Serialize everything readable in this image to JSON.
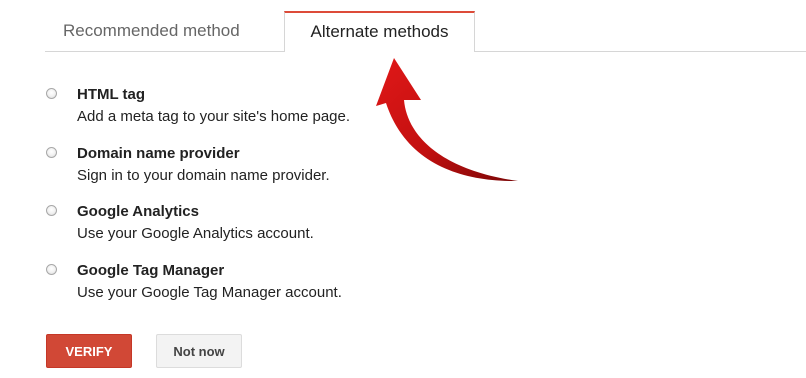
{
  "tabs": {
    "recommended": "Recommended method",
    "alternate": "Alternate methods",
    "active": "alternate"
  },
  "methods": [
    {
      "title": "HTML tag",
      "description": "Add a meta tag to your site's home page."
    },
    {
      "title": "Domain name provider",
      "description": "Sign in to your domain name provider."
    },
    {
      "title": "Google Analytics",
      "description": "Use your Google Analytics account."
    },
    {
      "title": "Google Tag Manager",
      "description": "Use your Google Tag Manager account."
    }
  ],
  "buttons": {
    "verify": "VERIFY",
    "not_now": "Not now"
  },
  "colors": {
    "accent": "#d14836",
    "arrow": "#c41414"
  },
  "annotation": {
    "arrow_icon": "curved-arrow-icon"
  }
}
